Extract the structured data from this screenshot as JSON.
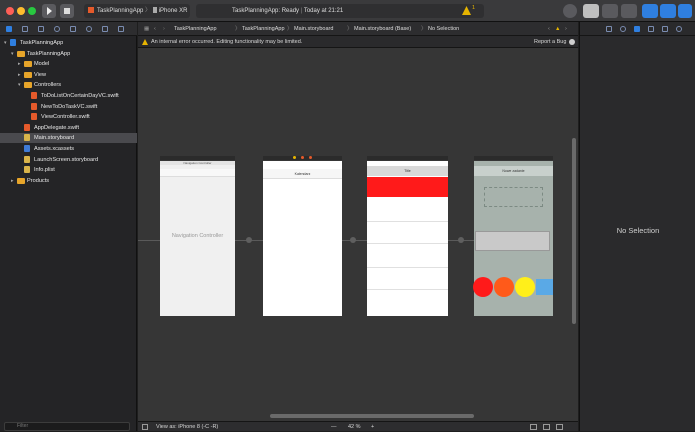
{
  "window": {
    "scheme_target": "TaskPlanningApp",
    "device": "iPhone XR",
    "status": "TaskPlanningApp: Ready",
    "status_time": "Today at 21:21",
    "warning_count": "1"
  },
  "navigator": {
    "filter_placeholder": "Filter",
    "items": [
      {
        "label": "TaskPlanningApp",
        "kind": "proj",
        "indent": 0,
        "disclosure": "open",
        "selected": false
      },
      {
        "label": "TaskPlanningApp",
        "kind": "folder",
        "indent": 1,
        "disclosure": "open",
        "selected": false
      },
      {
        "label": "Model",
        "kind": "folder",
        "indent": 2,
        "disclosure": "closed",
        "selected": false
      },
      {
        "label": "View",
        "kind": "folder",
        "indent": 2,
        "disclosure": "closed",
        "selected": false
      },
      {
        "label": "Controllers",
        "kind": "folder",
        "indent": 2,
        "disclosure": "open",
        "selected": false
      },
      {
        "label": "ToDoListOnCertainDayVC.swift",
        "kind": "swift",
        "indent": 3,
        "disclosure": "",
        "selected": false
      },
      {
        "label": "NewToDoTaskVC.swift",
        "kind": "swift",
        "indent": 3,
        "disclosure": "",
        "selected": false
      },
      {
        "label": "ViewController.swift",
        "kind": "swift",
        "indent": 3,
        "disclosure": "",
        "selected": false
      },
      {
        "label": "AppDelegate.swift",
        "kind": "swift",
        "indent": 2,
        "disclosure": "",
        "selected": false
      },
      {
        "label": "Main.storyboard",
        "kind": "sb",
        "indent": 2,
        "disclosure": "",
        "selected": true
      },
      {
        "label": "Assets.xcassets",
        "kind": "xc",
        "indent": 2,
        "disclosure": "",
        "selected": false
      },
      {
        "label": "LaunchScreen.storyboard",
        "kind": "sb",
        "indent": 2,
        "disclosure": "",
        "selected": false
      },
      {
        "label": "Info.plist",
        "kind": "sb",
        "indent": 2,
        "disclosure": "",
        "selected": false
      },
      {
        "label": "Products",
        "kind": "folder",
        "indent": 1,
        "disclosure": "closed",
        "selected": false
      }
    ]
  },
  "jumpbar": {
    "crumbs": [
      "TaskPlanningApp",
      "TaskPlanningApp",
      "Main.storyboard",
      "Main.storyboard (Base)",
      "No Selection"
    ]
  },
  "banner": {
    "message": "An internal error occurred. Editing functionality may be limited.",
    "report_label": "Report a Bug"
  },
  "canvas": {
    "nav_controller_label": "Navigation Controller",
    "scene1_title": "Navigation Controller",
    "scene2_title": "Kalendarz",
    "scene3_title": "Title",
    "scene4_title": "Nowe zadanie"
  },
  "bottombar": {
    "view_as": "View as: iPhone 8 (-C -R)",
    "zoom": "42 %",
    "zoom_out": "—",
    "zoom_in": "+"
  },
  "inspector": {
    "empty_label": "No Selection"
  },
  "colors": {
    "accent_red": "#ff1a1a",
    "accent_orange": "#ff5a1a",
    "accent_yellow": "#ffef1a",
    "accent_blue": "#5aa9e6",
    "selection": "#4a4a4e"
  }
}
